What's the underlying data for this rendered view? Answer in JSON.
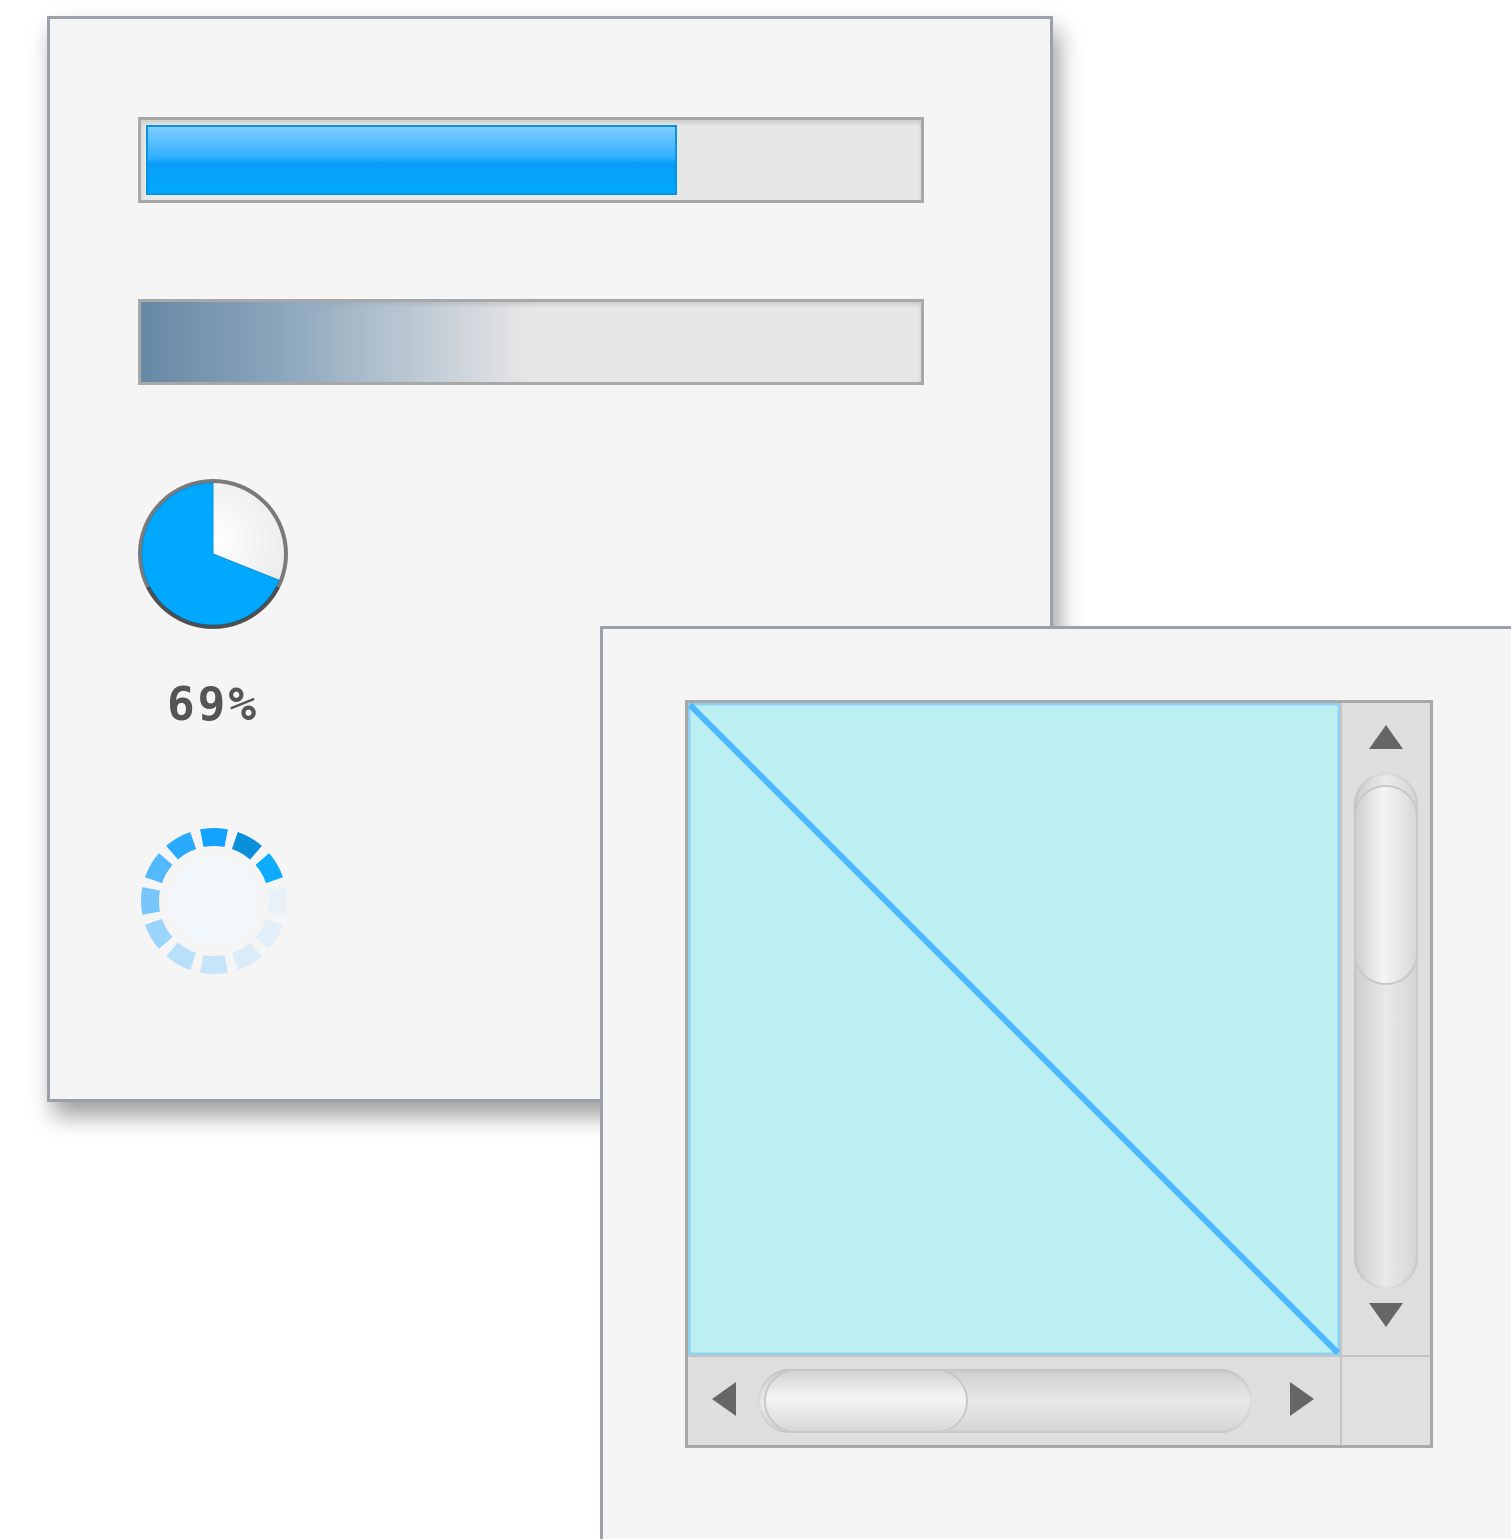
{
  "progress_panel": {
    "determinate_bar": {
      "value": 0.69
    },
    "indeterminate_bar": {
      "state": "indeterminate"
    },
    "progress_pie": {
      "value": 0.69,
      "label": "69%"
    },
    "spinner": {
      "state": "indeterminate"
    }
  },
  "scroll_panel": {
    "vertical_scrollbar": {
      "position": 0.0
    },
    "horizontal_scrollbar": {
      "position": 0.0
    }
  },
  "colors": {
    "accent": "#00a8ff",
    "viewport_fill": "#bbeff1",
    "diagonal_line": "#4db8ff",
    "panel_bg": "#f5f5f5"
  },
  "icons": {
    "up": "arrow-up-icon",
    "down": "arrow-down-icon",
    "left": "arrow-left-icon",
    "right": "arrow-right-icon"
  }
}
